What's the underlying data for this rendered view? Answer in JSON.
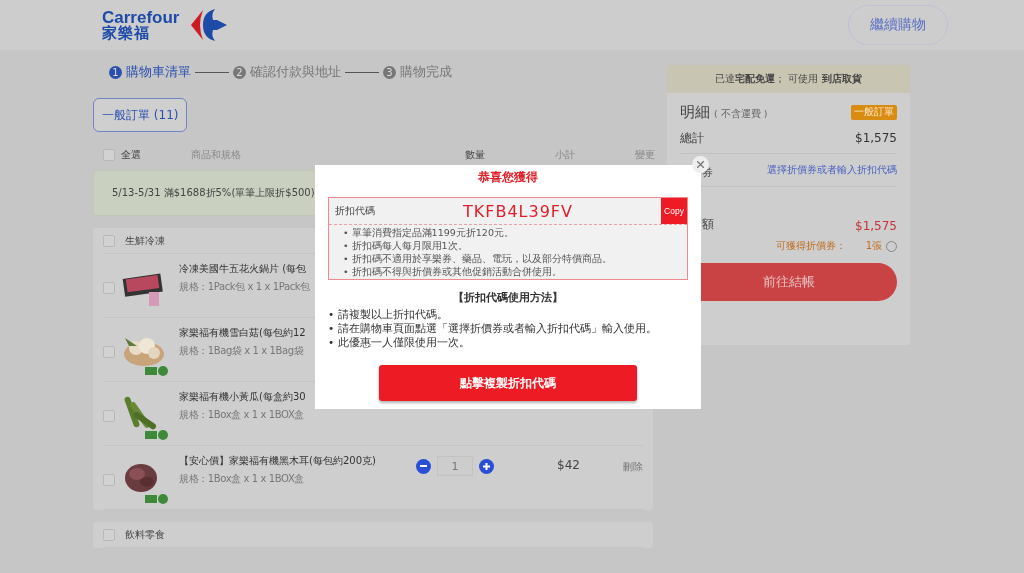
{
  "header": {
    "logo_text": "Carrefour",
    "logo_text_cn": "家樂福",
    "continue_button": "繼續購物"
  },
  "steps": [
    {
      "number": "1",
      "label": "購物車清單",
      "selected": true
    },
    {
      "number": "2",
      "label": "確認付款與地址",
      "selected": false
    },
    {
      "number": "3",
      "label": "購物完成",
      "selected": false
    }
  ],
  "order_tabs": [
    {
      "label": "一般訂單 (11)",
      "selected": true
    }
  ],
  "table_header": {
    "select_all": {
      "label": "全選",
      "checked": false
    },
    "columns": [
      "商品和規格",
      "數量",
      "小計",
      "變更"
    ]
  },
  "promo": "5/13-5/31 滿$1688折5%(單筆上限折$500)",
  "categories": [
    {
      "name": "生鮮冷凍",
      "checked": false,
      "items": [
        {
          "kind": "meat",
          "name": "冷凍美國牛五花火鍋片 (每包",
          "spec": "規格：1Pack包 x 1 x 1Pack包",
          "checked": false,
          "organic": false
        },
        {
          "kind": "mushroom",
          "name": "家樂福有機雪白菇(每包約12",
          "spec": "規格：1Bag袋 x 1 x 1Bag袋",
          "checked": false,
          "organic": true
        },
        {
          "kind": "cucumber",
          "name": "家樂福有機小黃瓜(每盒約30",
          "spec": "規格：1Box盒 x 1 x 1BOX盒",
          "checked": false,
          "organic": true
        },
        {
          "kind": "fungus",
          "name": "【安心價】家樂福有機黑木耳(每包約200克)",
          "spec": "規格：1Box盒 x 1 x 1BOX盒",
          "checked": false,
          "organic": true,
          "quantity": "1",
          "subtotal": "$42",
          "action": "刪除"
        }
      ]
    },
    {
      "name": "飲料零食",
      "checked": false
    }
  ],
  "summary": {
    "notice": "已達**宅配免運**； 可使用 **到店取貨**",
    "title": "明細",
    "title_note": "( 不含運費 )",
    "badge": "一般訂單",
    "total_label": "總計",
    "total_value": "$1,575",
    "coupon_label": "券",
    "coupon_link": "選擇折價券或者輸入折扣代碼",
    "payable_label": "額",
    "payable_value": "$1,575",
    "coupons_label": "可獲得折價券：",
    "coupons_count": "1張",
    "checkout_button": "前往結帳"
  },
  "modal": {
    "title": "恭喜您獲得",
    "code_label": "折扣代碼",
    "code": "TKFB4L39FV",
    "copy_button": "Copy",
    "terms": [
      "• 單筆消費指定品滿1199元折120元。",
      "• 折扣碼每人每月限用1次。",
      "• 折扣碼不適用於享樂券、藥品、電玩，以及部分特價商品。",
      "• 折扣碼不得與折價券或其他促銷活動合併使用。"
    ],
    "howto_title": "【折扣代碼使用方法】",
    "howto": [
      "• 請複製以上折扣代碼。",
      "• 請在購物車頁面點選「選擇折價券或者輸入折扣代碼」輸入使用。",
      "• 此優惠一人僅限使用一次。"
    ],
    "action_button": "點擊複製折扣代碼"
  }
}
